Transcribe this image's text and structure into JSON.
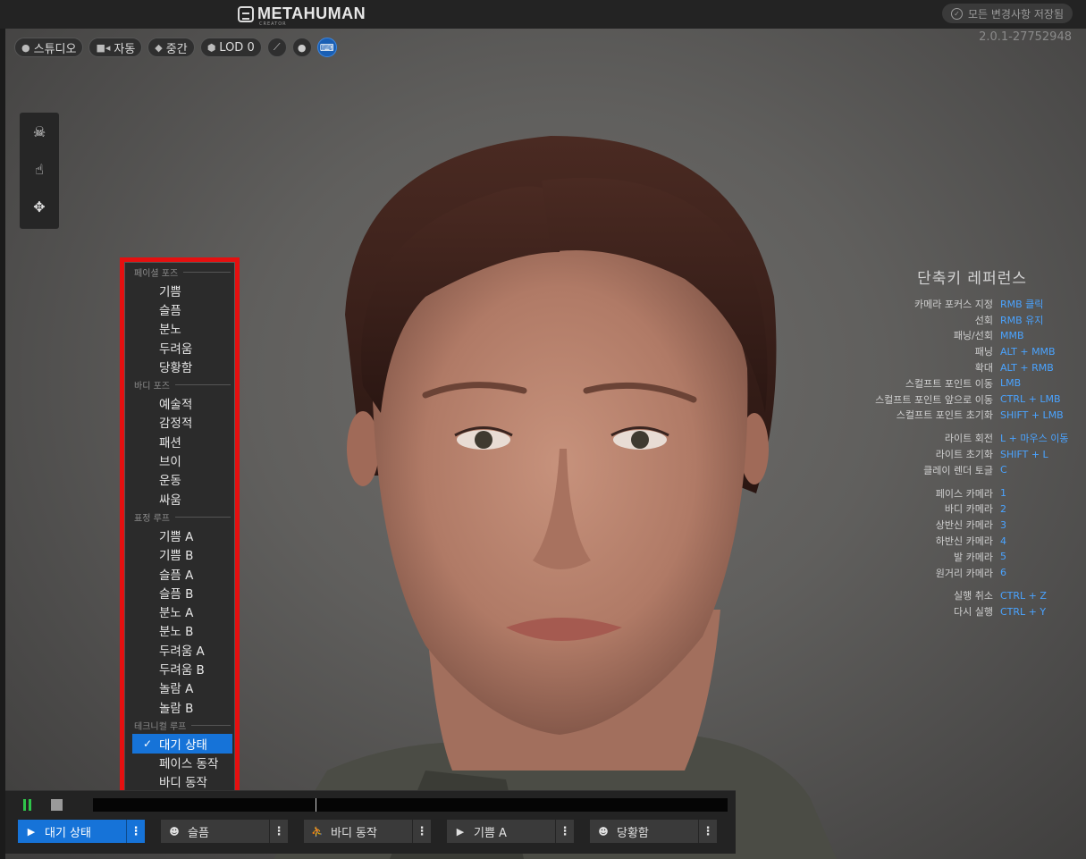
{
  "app": {
    "logo": "METAHUMAN",
    "logo_sub": "CREATOR",
    "save_status": "모든 변경사항 저장됨",
    "version": "2.0.1-27752948"
  },
  "toolbar": {
    "lighting": "스튜디오",
    "camera": "자동",
    "quality": "중간",
    "lod": "LOD 0"
  },
  "menu": {
    "sections": [
      {
        "header": "페이셜 포즈",
        "items": [
          "기쁨",
          "슬픔",
          "분노",
          "두려움",
          "당황함"
        ]
      },
      {
        "header": "바디 포즈",
        "items": [
          "예술적",
          "감정적",
          "패션",
          "브이",
          "운동",
          "싸움"
        ]
      },
      {
        "header": "표정 루프",
        "items": [
          "기쁨 A",
          "기쁨 B",
          "슬픔 A",
          "슬픔 B",
          "분노 A",
          "분노 B",
          "두려움 A",
          "두려움 B",
          "놀람 A",
          "놀람 B"
        ]
      },
      {
        "header": "테크니컬 루프",
        "items": [
          "대기 상태",
          "페이스 동작",
          "바디 동작"
        ]
      }
    ],
    "selected": "대기 상태"
  },
  "shortcuts": {
    "title": "단축키 레퍼런스",
    "groups": [
      [
        {
          "action": "카메라 포커스 지정",
          "key": "RMB 클릭"
        },
        {
          "action": "선회",
          "key": "RMB 유지"
        },
        {
          "action": "패닝/선회",
          "key": "MMB"
        },
        {
          "action": "패닝",
          "key": "ALT + MMB"
        },
        {
          "action": "확대",
          "key": "ALT + RMB"
        },
        {
          "action": "스컬프트 포인트 이동",
          "key": "LMB"
        },
        {
          "action": "스컬프트 포인트 앞으로 이동",
          "key": "CTRL + LMB"
        },
        {
          "action": "스컬프트 포인트 초기화",
          "key": "SHIFT + LMB"
        }
      ],
      [
        {
          "action": "라이트 회전",
          "key": "L + 마우스 이동"
        },
        {
          "action": "라이트 초기화",
          "key": "SHIFT + L"
        },
        {
          "action": "클레이 렌더 토글",
          "key": "C"
        }
      ],
      [
        {
          "action": "페이스 카메라",
          "key": "1"
        },
        {
          "action": "바디 카메라",
          "key": "2"
        },
        {
          "action": "상반신 카메라",
          "key": "3"
        },
        {
          "action": "하반신 카메라",
          "key": "4"
        },
        {
          "action": "발 카메라",
          "key": "5"
        },
        {
          "action": "원거리 카메라",
          "key": "6"
        }
      ],
      [
        {
          "action": "실행 취소",
          "key": "CTRL + Z"
        },
        {
          "action": "다시 실행",
          "key": "CTRL + Y"
        }
      ]
    ]
  },
  "playback": {
    "progress": 0.35,
    "tracks": [
      {
        "label": "대기 상태",
        "icon": "play-icon",
        "active": true
      },
      {
        "label": "슬픔",
        "icon": "face-icon",
        "active": false
      },
      {
        "label": "바디 동작",
        "icon": "running-icon",
        "active": false
      },
      {
        "label": "기쁨 A",
        "icon": "play-icon",
        "active": false
      },
      {
        "label": "당황함",
        "icon": "face-icon",
        "active": false
      }
    ]
  }
}
